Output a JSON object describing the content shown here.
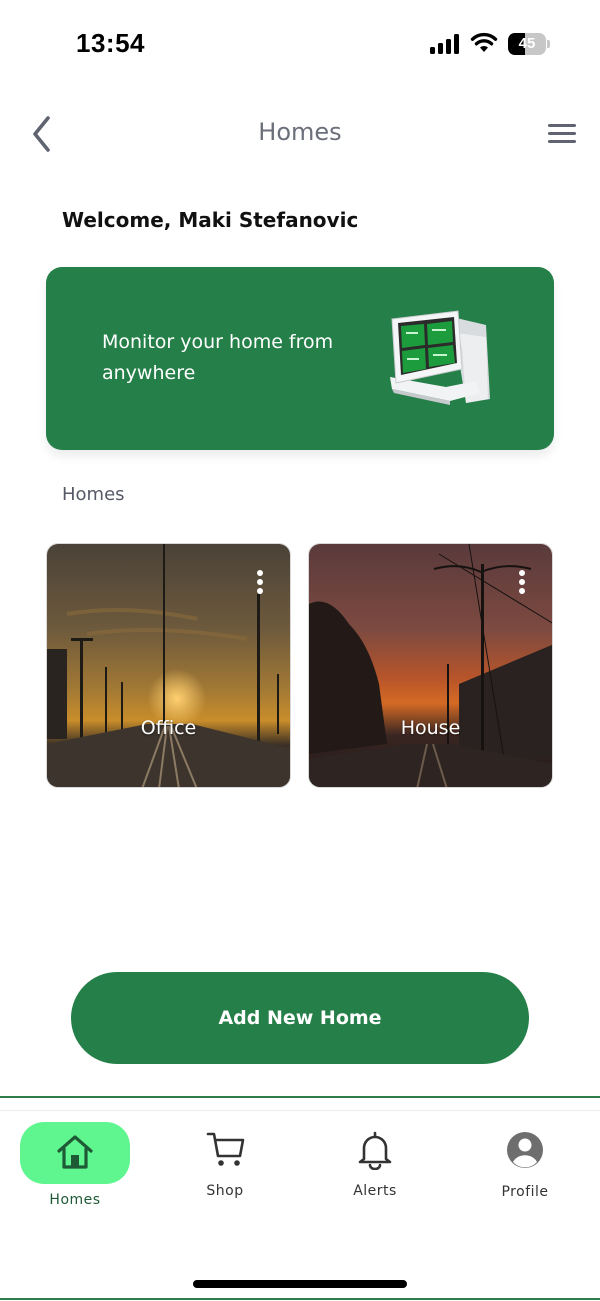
{
  "status_bar": {
    "time": "13:54",
    "battery_level": "45",
    "icons": [
      "signal-icon",
      "wifi-icon",
      "battery-icon"
    ]
  },
  "header": {
    "title": "Homes",
    "back_icon": "chevron-left-icon",
    "menu_icon": "hamburger-menu-icon"
  },
  "welcome": "Welcome, Maki Stefanovic",
  "promo": {
    "text": "Monitor your home from anywhere",
    "image": "thermostat-device-image"
  },
  "homes_section": {
    "title": "Homes",
    "cards": [
      {
        "label": "Office",
        "menu_icon": "more-vertical-icon"
      },
      {
        "label": "House",
        "menu_icon": "more-vertical-icon"
      }
    ]
  },
  "add_button": {
    "label": "Add New Home"
  },
  "bottom_nav": {
    "items": [
      {
        "label": "Homes",
        "icon": "home-icon",
        "active": true
      },
      {
        "label": "Shop",
        "icon": "cart-icon"
      },
      {
        "label": "Alerts",
        "icon": "bell-icon"
      },
      {
        "label": "Profile",
        "icon": "user-avatar-icon"
      }
    ]
  },
  "colors": {
    "brand_green": "#257f48",
    "active_nav_pill": "#5ff58f",
    "header_text": "#6b6f7a"
  }
}
